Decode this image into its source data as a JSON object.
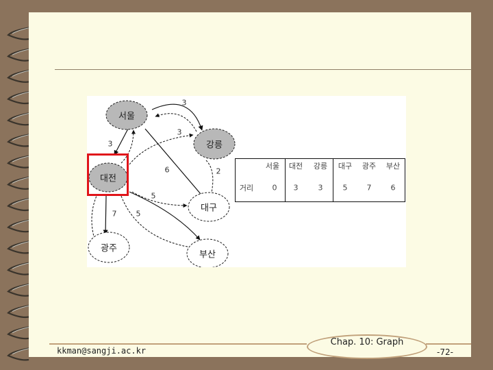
{
  "slide": {
    "footer": {
      "email": "kkman@sangji.ac.kr",
      "chapter": "Chap. 10: Graph",
      "page_number": "-72-"
    }
  },
  "graph": {
    "nodes": [
      {
        "id": "seoul",
        "label": "서울",
        "state": "visited"
      },
      {
        "id": "gangneung",
        "label": "강릉",
        "state": "visited"
      },
      {
        "id": "daejeon",
        "label": "대전",
        "state": "visited",
        "highlighted": true
      },
      {
        "id": "daegu",
        "label": "대구",
        "state": "unvisited"
      },
      {
        "id": "gwangju",
        "label": "광주",
        "state": "unvisited"
      },
      {
        "id": "busan",
        "label": "부산",
        "state": "unvisited"
      }
    ],
    "edges": [
      {
        "from": "seoul",
        "to": "gangneung",
        "weight": "3",
        "style": "solid"
      },
      {
        "from": "gangneung",
        "to": "seoul",
        "weight": "",
        "style": "dashed"
      },
      {
        "from": "seoul",
        "to": "daejeon",
        "weight": "3",
        "style": "solid"
      },
      {
        "from": "daejeon",
        "to": "seoul",
        "weight": "",
        "style": "dashed"
      },
      {
        "from": "daejeon",
        "to": "gangneung",
        "weight": "3",
        "style": "dashed"
      },
      {
        "from": "seoul",
        "to": "daegu",
        "weight": "6",
        "style": "solid"
      },
      {
        "from": "gangneung",
        "to": "daegu",
        "weight": "2",
        "style": "dashed"
      },
      {
        "from": "daejeon",
        "to": "daegu",
        "weight": "5",
        "style": "dashed"
      },
      {
        "from": "daejeon",
        "to": "gwangju",
        "weight": "7",
        "style": "solid"
      },
      {
        "from": "gwangju",
        "to": "daejeon",
        "weight": "",
        "style": "dashed"
      },
      {
        "from": "daejeon",
        "to": "busan",
        "weight": "5",
        "style": "dashed"
      },
      {
        "from": "daejeon",
        "to": "busan",
        "weight": "",
        "style": "solid"
      }
    ],
    "edge_labels": [
      "3",
      "3",
      "3",
      "6",
      "2",
      "5",
      "7",
      "5"
    ]
  },
  "distance_table": {
    "header": [
      "서울",
      "대전",
      "강릉",
      "대구",
      "광주",
      "부산"
    ],
    "row_label": "거리",
    "values": [
      "0",
      "3",
      "3",
      "5",
      "7",
      "6"
    ]
  },
  "colors": {
    "background": "#8b735c",
    "page": "#fcfbe4",
    "visited_node": "#b8b8b8",
    "highlight": "#e0141a",
    "footer_line": "#c0a07a"
  }
}
